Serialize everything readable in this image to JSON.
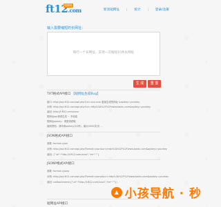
{
  "header": {
    "logo_text": "ft12",
    "logo_suffix": ".com",
    "logo_tag": "短网址",
    "nav": [
      {
        "label": "新浪短网址"
      },
      {
        "label": "统计"
      },
      {
        "label": "登录/注册"
      }
    ]
  },
  "form": {
    "label": "输入需要缩短的长网址：",
    "placeholder": "每行一个长网址，支持一次缩短10条长网址",
    "generate_label": "生 成",
    "reset_label": "重 置"
  },
  "api": {
    "title": "TXT格式API接口",
    "link_label": "【短网址生成Bug】",
    "txt_lines": [
      "接口: http://api.ft12.com/api.php?url=xxx.com 直接生成短网址 &apikey=yourkey",
      "示例: http://api.ft12.com/api.php?url=http%3A%2F%2Fwww.baidu.com&apikey=yourkey",
      "返回: http://t.ft12.com/xxxx",
      "短网址api请求生成 ~ 不收费",
      "短网址apikey：请登录获取",
      "使用须知：请申请apikey(QQ号)，最大2000次/天 ..."
    ],
    "json_title": "JSON格式API接口",
    "json_lines": [
      "参数: format=json",
      "示例: http://api.ft12.com/api.php?format=json&url=http%3A%2F%2Fwww.baidu.com&apikey=yourkey",
      "返回: {\"url\":\"http://t.ft12.com/xxxx\",\"err\":\"\"}"
    ],
    "jsonp_title": "JSONP格式API接口",
    "jsonp_lines": [
      "参数: format=jsonp",
      "示例: http://api.ft12.com/api.php?format=jsonp&url=http%3A%2F%2Fwww.baidu.com&apikey=yourkey",
      "返回: callbackname({\"url\":\"http://t.ft12.com/xxxx\",\"err\":\"\"})"
    ],
    "footer_title": "短网址API接口"
  },
  "watermark": {
    "text": "小孩导航 · 秒"
  }
}
